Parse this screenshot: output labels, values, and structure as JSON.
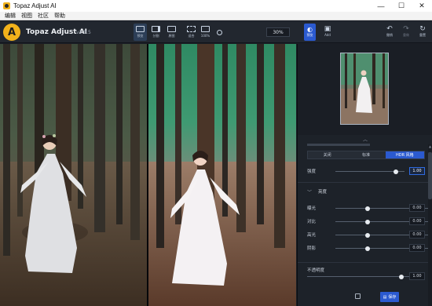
{
  "window": {
    "title": "Topaz Adjust AI",
    "controls": [
      "—",
      "☐",
      "✕"
    ]
  },
  "menu": [
    "编辑",
    "视图",
    "社区",
    "帮助"
  ],
  "toolbar": {
    "brand": "Topaz Adjust AI",
    "version": "v1.0.5",
    "view_buttons": [
      {
        "label": "预览",
        "active": true
      },
      {
        "label": "分割",
        "active": false
      },
      {
        "label": "原图",
        "active": false
      },
      {
        "label": "适合",
        "active": false
      },
      {
        "label": "100%",
        "active": false
      }
    ],
    "zoom": "30%",
    "compare_label": "预览",
    "add_label": "Add",
    "undo_label": "撤销",
    "redo_label": "重做",
    "reset_label": "重置"
  },
  "panel": {
    "modes": [
      {
        "label": "关闭",
        "selected": false
      },
      {
        "label": "标准",
        "selected": false
      },
      {
        "label": "HDR 风格",
        "selected": true
      }
    ],
    "strength": {
      "label": "强度",
      "value": "1.00",
      "level": 0.88
    },
    "brightness_header": "亮度",
    "sliders": [
      {
        "label": "曝光",
        "value": "0.00",
        "level": 0.5
      },
      {
        "label": "对比",
        "value": "0.00",
        "level": 0.5
      },
      {
        "label": "高光",
        "value": "0.00",
        "level": 0.5
      },
      {
        "label": "阴影",
        "value": "0.00",
        "level": 0.5
      }
    ],
    "opacity": {
      "label": "不透明度",
      "value": "1.00",
      "level": 0.92
    },
    "save_label": "保存"
  },
  "colors": {
    "accent": "#2b5ad0",
    "brand": "#f2b21b"
  }
}
